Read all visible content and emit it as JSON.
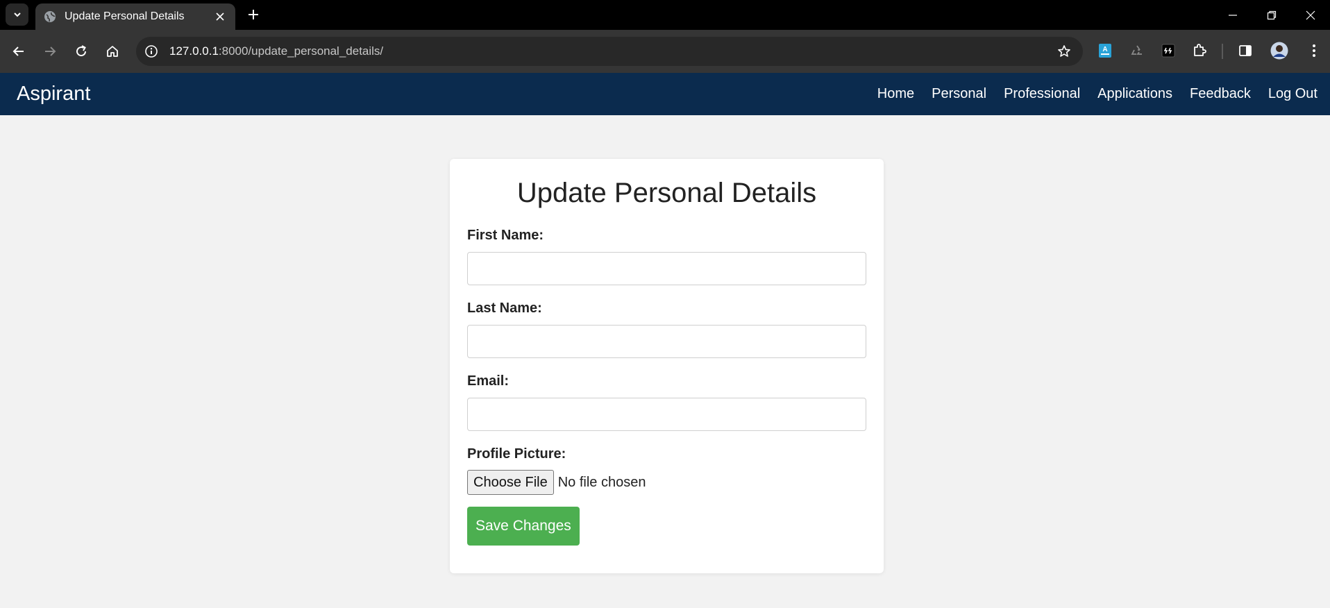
{
  "browser": {
    "tab_title": "Update Personal Details",
    "url_host": "127.0.0.1",
    "url_rest": ":8000/update_personal_details/"
  },
  "navbar": {
    "brand": "Aspirant",
    "links": [
      "Home",
      "Personal",
      "Professional",
      "Applications",
      "Feedback",
      "Log Out"
    ]
  },
  "form": {
    "title": "Update Personal Details",
    "first_name_label": "First Name:",
    "first_name_value": "",
    "last_name_label": "Last Name:",
    "last_name_value": "",
    "email_label": "Email:",
    "email_value": "",
    "picture_label": "Profile Picture:",
    "choose_file_label": "Choose File",
    "file_status": "No file chosen",
    "submit_label": "Save Changes"
  },
  "colors": {
    "navbar_bg": "#0b2b4e",
    "page_bg": "#f2f2f2",
    "submit_bg": "#4caf50"
  }
}
